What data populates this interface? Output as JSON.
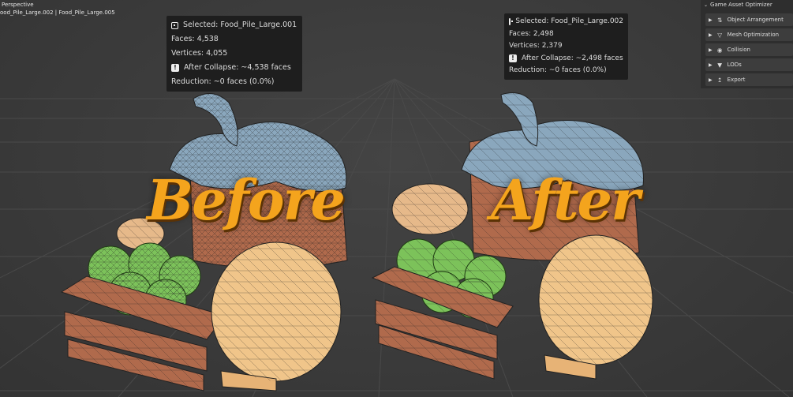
{
  "viewport": {
    "mode_label": "Perspective",
    "collection_label": "ood_Pile_Large.002 | Food_Pile_Large.005"
  },
  "before_panel": {
    "selected": "Selected: Food_Pile_Large.001",
    "faces": "Faces: 4,538",
    "vertices": "Vertices: 4,055",
    "after_collapse": "After Collapse: ~4,538 faces",
    "reduction": "Reduction: ~0 faces (0.0%)"
  },
  "after_panel": {
    "selected": "Selected: Food_Pile_Large.002",
    "faces": "Faces: 2,498",
    "vertices": "Vertices: 2,379",
    "after_collapse": "After Collapse: ~2,498 faces",
    "reduction": "Reduction: ~0 faces (0.0%)"
  },
  "labels": {
    "before": "Before",
    "after": "After"
  },
  "optimizer": {
    "title": "Game Asset Optimizer",
    "items": [
      {
        "label": "Object Arrangement",
        "icon": "arrange-icon"
      },
      {
        "label": "Mesh Optimization",
        "icon": "mesh-icon"
      },
      {
        "label": "Collision",
        "icon": "collision-icon"
      },
      {
        "label": "LODs",
        "icon": "lod-icon"
      },
      {
        "label": "Export",
        "icon": "export-icon"
      }
    ]
  },
  "colors": {
    "viewport_bg": "#3a3a3a",
    "label_orange": "#f4a41d",
    "wood": "#b06a4c",
    "apple_green": "#7cc25a",
    "cheese": "#f0c58a",
    "pumpkin_blue": "#8aa7bd"
  }
}
